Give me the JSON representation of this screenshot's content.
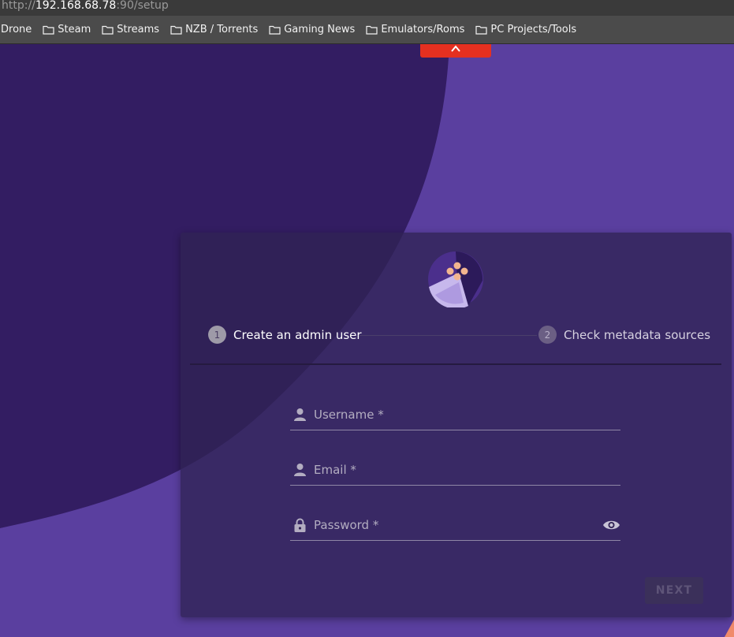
{
  "browser": {
    "url_scheme": "http://",
    "url_host": "192.168.68.78",
    "url_rest": ":90/setup",
    "bookmarks": [
      {
        "label": "Drone",
        "icon": "folder-icon"
      },
      {
        "label": "Steam",
        "icon": "folder-icon"
      },
      {
        "label": "Streams",
        "icon": "folder-icon"
      },
      {
        "label": "NZB / Torrents",
        "icon": "folder-icon"
      },
      {
        "label": "Gaming News",
        "icon": "folder-icon"
      },
      {
        "label": "Emulators/Roms",
        "icon": "folder-icon"
      },
      {
        "label": "PC Projects/Tools",
        "icon": "folder-icon"
      }
    ]
  },
  "setup": {
    "logo_icon": "gamepad-logo-icon",
    "steps": [
      {
        "number": "1",
        "label": "Create an admin user",
        "active": true
      },
      {
        "number": "2",
        "label": "Check metadata sources",
        "active": false
      }
    ],
    "fields": {
      "username": {
        "label": "Username *",
        "icon": "person-icon"
      },
      "email": {
        "label": "Email *",
        "icon": "person-icon"
      },
      "password": {
        "label": "Password *",
        "icon": "lock-icon",
        "toggle_icon": "eye-icon"
      }
    },
    "next_label": "NEXT"
  },
  "colors": {
    "background": "#5a3f9f",
    "background_dark": "#331d62",
    "card": "#2f2354",
    "accent_red": "#e53020"
  }
}
